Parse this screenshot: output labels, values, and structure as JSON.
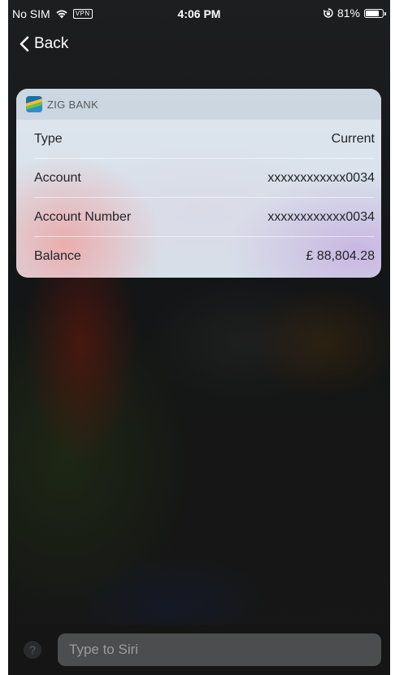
{
  "status_bar": {
    "carrier": "No SIM",
    "vpn": "VPN",
    "time": "4:06 PM",
    "battery": "81%",
    "battery_level": 0.81
  },
  "nav": {
    "back_label": "Back"
  },
  "card": {
    "app_name": "ZIG BANK",
    "rows": [
      {
        "label": "Type",
        "value": "Current"
      },
      {
        "label": "Account",
        "value": "xxxxxxxxxxxx0034"
      },
      {
        "label": "Account Number",
        "value": "xxxxxxxxxxxx0034"
      },
      {
        "label": "Balance",
        "value": "£ 88,804.28"
      }
    ]
  },
  "siri": {
    "help_label": "?",
    "placeholder": "Type to Siri"
  },
  "icons": {
    "wifi": "wifi-icon",
    "orientation_lock": "orientation-lock-icon",
    "battery": "battery-icon",
    "back": "chevron-left-icon",
    "app_logo": "zig-bank-logo-icon"
  },
  "colors": {
    "screen_background": "#141516",
    "card_background": "#dde6ee",
    "input_background": "#4b4d4e"
  }
}
